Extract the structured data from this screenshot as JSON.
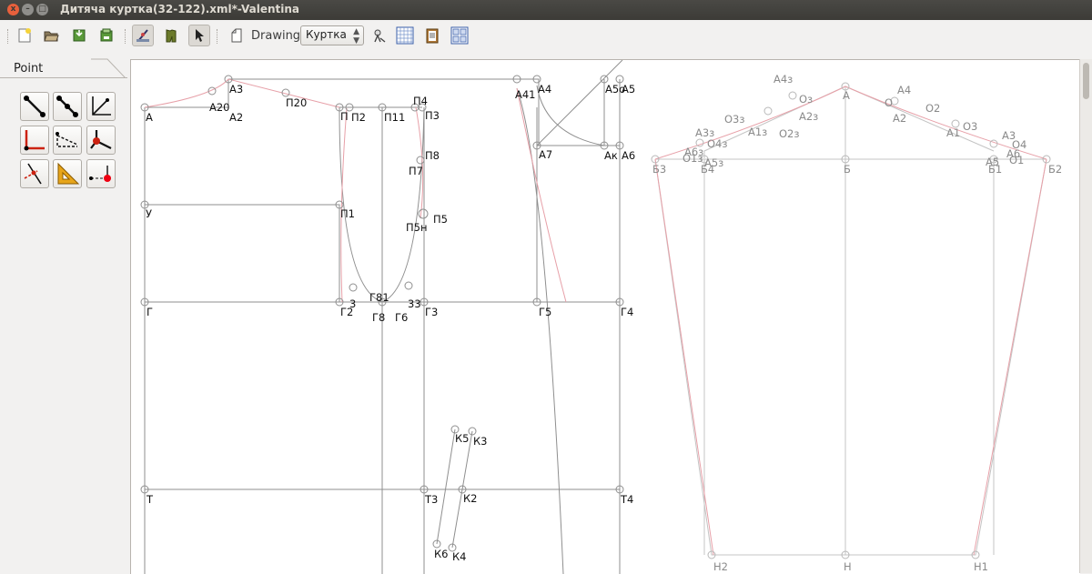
{
  "window": {
    "title": "Дитяча куртка(32-122).xml*-Valentina",
    "controls": [
      "x",
      "–",
      "□"
    ]
  },
  "toolbar": {
    "drawing_label": "Drawing:",
    "drawing_value": "Куртка",
    "icons": [
      "new-file-icon",
      "open-file-icon",
      "save-icon",
      "save-as-icon",
      "draw-mode-icon",
      "details-mode-icon",
      "arrow-pointer-icon",
      "new-drawing-icon",
      "history-icon",
      "table-icon",
      "clipboard-icon",
      "layout-icon"
    ]
  },
  "panel": {
    "tab_label": "Point",
    "tools": [
      "line-point-tool",
      "along-line-tool",
      "bisector-tool",
      "normal-tool",
      "shoulder-point-tool",
      "curve-point-tool",
      "intersection-tool",
      "triangle-tool",
      "height-tool"
    ]
  },
  "labels_left": [
    "А",
    "А20",
    "А3",
    "А2",
    "П20",
    "П",
    "П2",
    "П11",
    "П4",
    "П3",
    "А41",
    "А4",
    "А5о",
    "А5",
    "П8",
    "П7",
    "А7",
    "Ак",
    "А6",
    "У",
    "П1",
    "П5",
    "П5н",
    "Г81",
    "3",
    "33",
    "Г",
    "Г2",
    "Г8",
    "Г6",
    "Г3",
    "Г5",
    "Г4",
    "К5",
    "К3",
    "Т",
    "Т3",
    "К2",
    "Т4",
    "К6",
    "К4"
  ],
  "labels_right": [
    "А4з",
    "Оз",
    "А",
    "А4",
    "О",
    "А2з",
    "О2",
    "А2",
    "О3з",
    "А1з",
    "О2з",
    "О3",
    "А1",
    "А3з",
    "О4з",
    "А3",
    "О4",
    "А6з",
    "А6",
    "О1з",
    "А5з",
    "О1",
    "Б3",
    "Б4",
    "Б",
    "Б1",
    "А5",
    "Б2",
    "Н2",
    "Н",
    "Н1"
  ]
}
